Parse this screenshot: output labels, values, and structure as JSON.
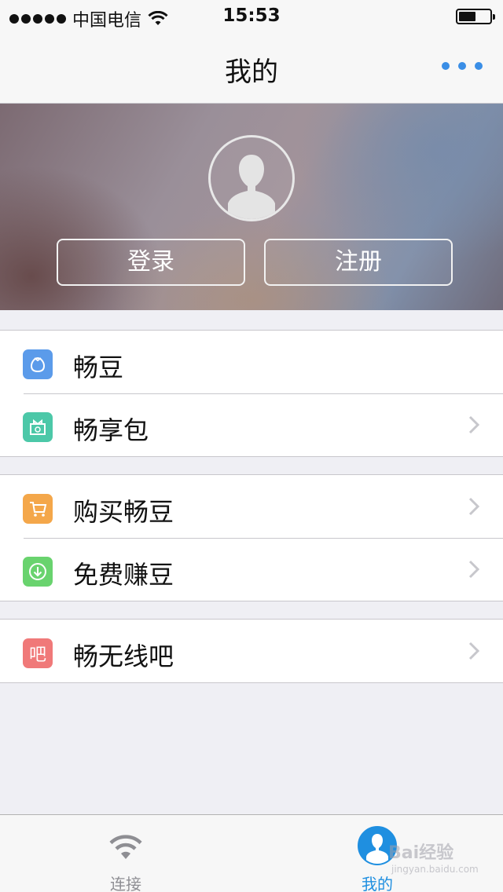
{
  "status_bar": {
    "carrier": "中国电信",
    "time": "15:53",
    "signal_icon": "signal-dots-icon",
    "wifi_icon": "wifi-icon",
    "battery_icon": "battery-icon",
    "battery_level": 0.55
  },
  "nav": {
    "title": "我的",
    "more_icon": "more-dots-icon",
    "accent": "#3a8ee6"
  },
  "profile": {
    "avatar_icon": "default-avatar-icon",
    "login_label": "登录",
    "register_label": "注册"
  },
  "groups": [
    {
      "items": [
        {
          "label": "畅豆",
          "icon": "purse-icon",
          "color": "#5b9bea",
          "chevron": false
        },
        {
          "label": "畅享包",
          "icon": "gift-icon",
          "color": "#4cc8a8",
          "chevron": true
        }
      ]
    },
    {
      "items": [
        {
          "label": "购买畅豆",
          "icon": "cart-icon",
          "color": "#f4a74a",
          "chevron": true
        },
        {
          "label": "免费赚豆",
          "icon": "download-icon",
          "color": "#69d36e",
          "chevron": true
        }
      ]
    },
    {
      "items": [
        {
          "label": "畅无线吧",
          "icon": "bar-icon",
          "icon_text": "吧",
          "color": "#f07979",
          "chevron": true
        }
      ]
    }
  ],
  "tab_bar": {
    "tabs": [
      {
        "label": "连接",
        "icon": "wifi-icon",
        "active": false
      },
      {
        "label": "我的",
        "icon": "user-avatar-icon",
        "active": true
      }
    ],
    "active_color": "#1f8fe0",
    "inactive_color": "#8e8e93"
  },
  "watermark": {
    "brand": "Bai经验",
    "url": "jingyan.baidu.com"
  }
}
